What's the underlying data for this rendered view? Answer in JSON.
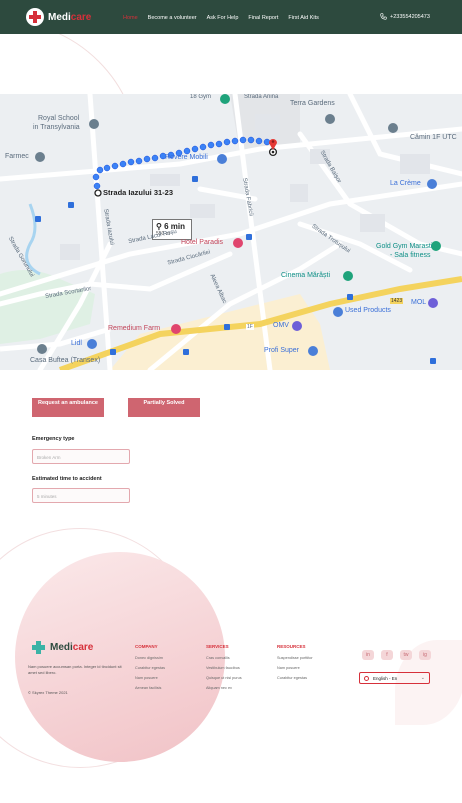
{
  "header": {
    "brand": {
      "part1": "Medi",
      "part2": "care"
    },
    "nav": [
      {
        "label": "Home",
        "active": true
      },
      {
        "label": "Become a volunteer",
        "active": false
      },
      {
        "label": "Ask For Help",
        "active": false
      },
      {
        "label": "Final Report",
        "active": false
      },
      {
        "label": "First Aid Kits",
        "active": false
      }
    ],
    "phone": "+233554205473"
  },
  "map": {
    "route": {
      "time": "6 min",
      "distance": "550 m"
    },
    "labels": {
      "gym18": "18 Gym",
      "strada_anina": "Strada Anina",
      "terra": "Terra Gardens",
      "royal": "Royal School",
      "royal2": "in Transylvania",
      "camin": "Cămin 1F UTC",
      "farmec": "Farmec",
      "rovere": "Rovere Mobili",
      "baisor": "Strada Baișor",
      "la_creme": "La Crème",
      "origin": "Strada Iazului 31-23",
      "fabricii": "Strada Fabricii",
      "iazului": "Strada Iazului",
      "lacul_rosu": "Strada Lacul Roșu",
      "paradis": "Hotel Paradis",
      "trotusului": "Strada Trotușului",
      "gold_gym": "Gold Gym Marasti",
      "gold_gym2": "- Sala fitness",
      "gorunului": "Strada Gorunului",
      "ciocarliei": "Strada Ciocârliei",
      "cinema": "Cinema Mărăști",
      "scortarilor": "Strada Scortarilor",
      "albac": "Aleea Albac",
      "mol": "MOL",
      "used": "Used Products",
      "remedium": "Remedium Farm",
      "omv": "OMV",
      "lidl": "Lidl",
      "profi": "Profi Super",
      "bufea": "Casa Buftea (Transex)",
      "road_1f": "1F",
      "road_1423": "1423"
    }
  },
  "actions": {
    "request": "Request an ambulance",
    "partially": "Partially Solved"
  },
  "form": {
    "emergency_label": "Emergency type",
    "emergency_placeholder": "Broken Arm",
    "time_label": "Estimated time to accident",
    "time_placeholder": "5 minutes"
  },
  "footer": {
    "brand": {
      "part1": "Medi",
      "part2": "care"
    },
    "description": "Nam posuere accumsan porta. Integer id tincidunt sit amet sed libero.",
    "copyright": "© Skyrex Theme 2021",
    "columns": [
      {
        "title": "COMPANY",
        "items": [
          "Donec dignissim",
          "Curabitur egestas",
          "Nam posuere",
          "Aenean facilisis"
        ]
      },
      {
        "title": "SERVICES",
        "items": [
          "Cras convallis",
          "Vestibulum faucibus",
          "Quisque ut nisl purus",
          "Aliquam nec ex"
        ]
      },
      {
        "title": "RESOURCES",
        "items": [
          "Suspendisse porttitor",
          "Nam posuere",
          "Curabitur egestas"
        ]
      }
    ],
    "socials": [
      "in",
      "f",
      "tw",
      "ig"
    ],
    "language": "English - En"
  },
  "colors": {
    "header_bg": "#2d4a3e",
    "accent": "#d6303a",
    "button": "#cf6570",
    "route": "#3b82f6"
  }
}
